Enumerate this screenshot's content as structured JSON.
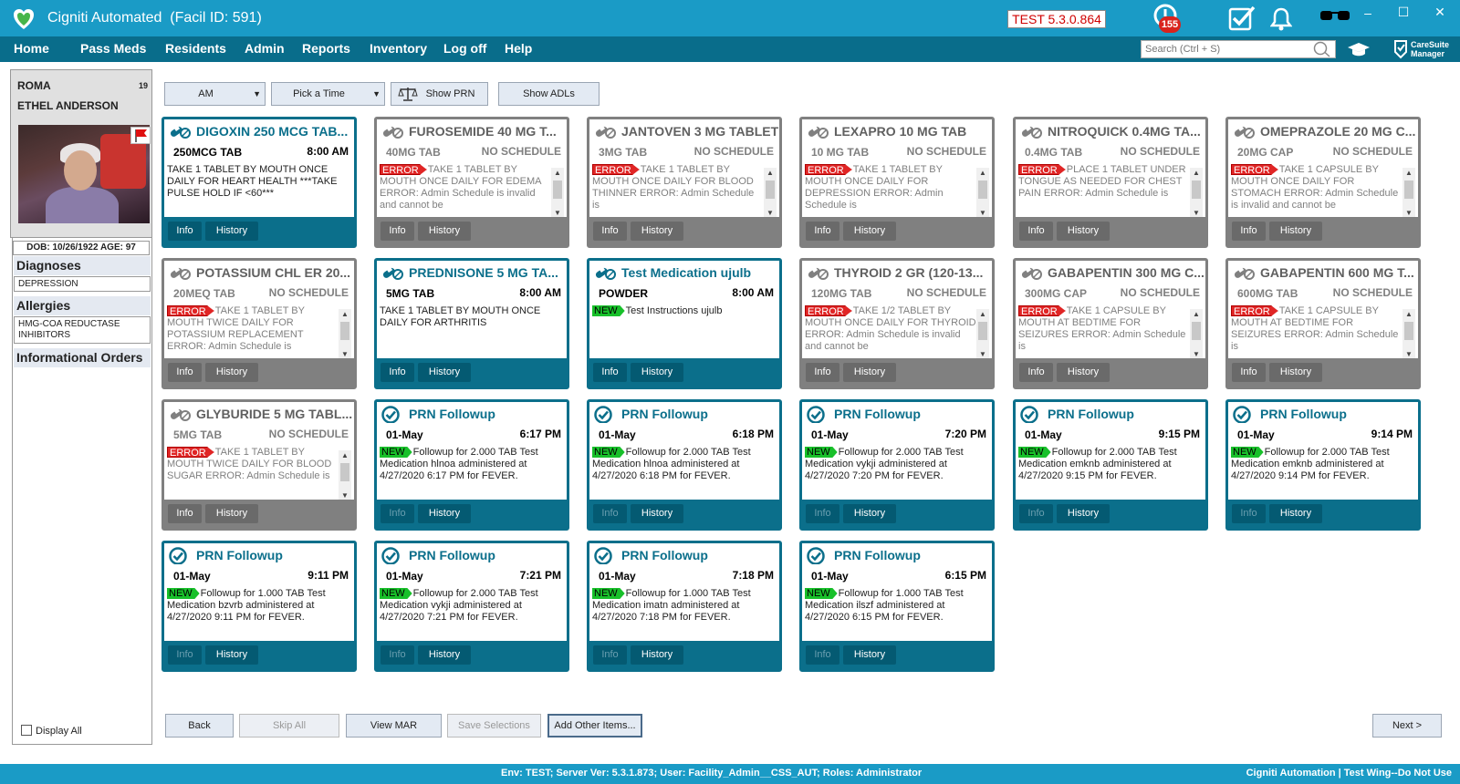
{
  "window": {
    "title": "Cigniti Automated",
    "facility_label": "(Facil ID: 591)",
    "version": "TEST 5.3.0.864",
    "alert_count": "155",
    "controls": [
      "–",
      "☐",
      "✕"
    ]
  },
  "menu": {
    "items": [
      "Home",
      "Pass Meds",
      "Residents",
      "Admin",
      "Reports",
      "Inventory",
      "Log off",
      "Help"
    ]
  },
  "search": {
    "placeholder": "Search (Ctrl + S)"
  },
  "brand": {
    "line1": "CareSuite",
    "line2": "Manager"
  },
  "patient": {
    "room": "ROMA",
    "name": "ETHEL ANDERSON",
    "room_number": "19",
    "dob": "DOB: 10/26/1922 AGE: 97"
  },
  "sidebar": {
    "diagnoses_label": "Diagnoses",
    "diagnoses": "DEPRESSION",
    "allergies_label": "Allergies",
    "allergies": "HMG-COA REDUCTASE INHIBITORS",
    "informational_label": "Informational Orders",
    "display_all": "Display All"
  },
  "toolbar": {
    "period": "AM",
    "time": "Pick a Time",
    "show_prn": "Show PRN",
    "show_adls": "Show ADLs"
  },
  "footer_buttons": {
    "back": "Back",
    "skip_all": "Skip All",
    "view_mar": "View MAR",
    "save_selections": "Save Selections",
    "add_other": "Add Other Items...",
    "next": "Next  >"
  },
  "card_buttons": {
    "info": "Info",
    "history": "History"
  },
  "cards": [
    {
      "title": "DIGOXIN 250 MCG TAB...",
      "dose": "250MCG TAB",
      "time": "8:00 AM",
      "status": "active",
      "badge": "",
      "text": " TAKE 1 TABLET BY MOUTH ONCE DAILY FOR HEART HEALTH    ***TAKE PULSE HOLD IF <60***",
      "icon": "pills-icon",
      "scroll": false
    },
    {
      "title": "FUROSEMIDE 40 MG T...",
      "dose": "40MG TAB",
      "time": "NO SCHEDULE",
      "status": "inactive",
      "badge": "ERROR",
      "text": "TAKE 1 TABLET BY MOUTH ONCE DAILY FOR EDEMA  ERROR: Admin Schedule is invalid and cannot be",
      "icon": "pills-icon",
      "scroll": true
    },
    {
      "title": "JANTOVEN 3 MG TABLET",
      "dose": "3MG TAB",
      "time": "NO SCHEDULE",
      "status": "inactive",
      "badge": "ERROR",
      "text": "TAKE 1 TABLET BY MOUTH ONCE DAILY FOR BLOOD THINNER  ERROR: Admin Schedule is",
      "icon": "pills-icon",
      "scroll": true
    },
    {
      "title": "LEXAPRO 10 MG TAB",
      "dose": "10 MG TAB",
      "time": "NO SCHEDULE",
      "status": "inactive",
      "badge": "ERROR",
      "text": "TAKE 1 TABLET BY MOUTH ONCE DAILY FOR DEPRESSION  ERROR: Admin Schedule is",
      "icon": "pills-icon",
      "scroll": true
    },
    {
      "title": "NITROQUICK 0.4MG TA...",
      "dose": "0.4MG TAB",
      "time": "NO SCHEDULE",
      "status": "inactive",
      "badge": "ERROR",
      "text": "PLACE 1 TABLET UNDER TONGUE AS NEEDED FOR CHEST PAIN  ERROR: Admin Schedule is",
      "icon": "pills-icon",
      "scroll": true
    },
    {
      "title": "OMEPRAZOLE 20 MG C...",
      "dose": "20MG CAP",
      "time": "NO SCHEDULE",
      "status": "inactive",
      "badge": "ERROR",
      "text": "TAKE 1 CAPSULE BY MOUTH ONCE DAILY FOR STOMACH  ERROR: Admin Schedule is invalid and cannot be",
      "icon": "pills-icon",
      "scroll": true
    },
    {
      "title": "POTASSIUM CHL ER 20...",
      "dose": "20MEQ TAB",
      "time": "NO SCHEDULE",
      "status": "inactive",
      "badge": "ERROR",
      "text": "TAKE 1 TABLET BY MOUTH TWICE DAILY FOR POTASSIUM REPLACEMENT  ERROR: Admin Schedule is",
      "icon": "pills-icon",
      "scroll": true
    },
    {
      "title": "PREDNISONE 5 MG TA...",
      "dose": "5MG TAB",
      "time": "8:00 AM",
      "status": "active",
      "badge": "",
      "text": " TAKE 1 TABLET BY MOUTH ONCE DAILY FOR ARTHRITIS",
      "icon": "pills-icon",
      "scroll": false
    },
    {
      "title": "Test Medication ujulb",
      "dose": "POWDER",
      "time": "8:00 AM",
      "status": "active",
      "badge": "NEW",
      "text": "Test Instructions ujulb",
      "icon": "pills-icon",
      "scroll": false
    },
    {
      "title": "THYROID 2 GR (120-13...",
      "dose": "120MG TAB",
      "time": "NO SCHEDULE",
      "status": "inactive",
      "badge": "ERROR",
      "text": "TAKE 1/2 TABLET BY MOUTH ONCE DAILY FOR THYROID  ERROR: Admin Schedule is invalid and cannot be",
      "icon": "pills-icon",
      "scroll": true
    },
    {
      "title": "GABAPENTIN 300 MG C...",
      "dose": "300MG CAP",
      "time": "NO SCHEDULE",
      "status": "inactive",
      "badge": "ERROR",
      "text": "TAKE 1 CAPSULE BY MOUTH AT BEDTIME FOR SEIZURES  ERROR: Admin Schedule is",
      "icon": "pills-icon",
      "scroll": true
    },
    {
      "title": "GABAPENTIN 600 MG T...",
      "dose": "600MG TAB",
      "time": "NO SCHEDULE",
      "status": "inactive",
      "badge": "ERROR",
      "text": "TAKE 1 CAPSULE BY MOUTH AT BEDTIME FOR SEIZURES  ERROR: Admin Schedule is",
      "icon": "pills-icon",
      "scroll": true
    },
    {
      "title": "GLYBURIDE 5 MG TABL...",
      "dose": "5MG TAB",
      "time": "NO SCHEDULE",
      "status": "inactive",
      "badge": "ERROR",
      "text": "TAKE 1 TABLET BY MOUTH TWICE DAILY FOR BLOOD SUGAR  ERROR: Admin Schedule is",
      "icon": "pills-icon",
      "scroll": true
    },
    {
      "title": "PRN Followup",
      "dose": "01-May",
      "time": "6:17 PM",
      "status": "active",
      "badge": "NEW",
      "text": "Followup for 2.000 TAB Test Medication hlnoa administered at 4/27/2020 6:17 PM for FEVER.",
      "icon": "check-circle-icon",
      "scroll": false,
      "dim_info": true
    },
    {
      "title": "PRN Followup",
      "dose": "01-May",
      "time": "6:18 PM",
      "status": "active",
      "badge": "NEW",
      "text": "Followup for 2.000 TAB Test Medication hlnoa administered at 4/27/2020 6:18 PM for FEVER.",
      "icon": "check-circle-icon",
      "scroll": false,
      "dim_info": true
    },
    {
      "title": "PRN Followup",
      "dose": "01-May",
      "time": "7:20 PM",
      "status": "active",
      "badge": "NEW",
      "text": "Followup for 2.000 TAB Test Medication vykji administered at 4/27/2020 7:20 PM for FEVER.",
      "icon": "check-circle-icon",
      "scroll": false,
      "dim_info": true
    },
    {
      "title": "PRN Followup",
      "dose": "01-May",
      "time": "9:15 PM",
      "status": "active",
      "badge": "NEW",
      "text": "Followup for 2.000 TAB Test Medication emknb administered at 4/27/2020 9:15 PM for FEVER.",
      "icon": "check-circle-icon",
      "scroll": false,
      "dim_info": true
    },
    {
      "title": "PRN Followup",
      "dose": "01-May",
      "time": "9:14 PM",
      "status": "active",
      "badge": "NEW",
      "text": "Followup for 2.000 TAB Test Medication emknb administered at 4/27/2020 9:14 PM for FEVER.",
      "icon": "check-circle-icon",
      "scroll": false,
      "dim_info": true
    },
    {
      "title": "PRN Followup",
      "dose": "01-May",
      "time": "9:11 PM",
      "status": "active",
      "badge": "NEW",
      "text": "Followup for 1.000 TAB Test Medication bzvrb administered at 4/27/2020 9:11 PM for FEVER.",
      "icon": "check-circle-icon",
      "scroll": false,
      "dim_info": true
    },
    {
      "title": "PRN Followup",
      "dose": "01-May",
      "time": "7:21 PM",
      "status": "active",
      "badge": "NEW",
      "text": "Followup for 2.000 TAB Test Medication vykji administered at 4/27/2020 7:21 PM for FEVER.",
      "icon": "check-circle-icon",
      "scroll": false,
      "dim_info": true
    },
    {
      "title": "PRN Followup",
      "dose": "01-May",
      "time": "7:18 PM",
      "status": "active",
      "badge": "NEW",
      "text": "Followup for 1.000 TAB Test Medication imatn administered at 4/27/2020 7:18 PM for FEVER.",
      "icon": "check-circle-icon",
      "scroll": false,
      "dim_info": true
    },
    {
      "title": "PRN Followup",
      "dose": "01-May",
      "time": "6:15 PM",
      "status": "active",
      "badge": "NEW",
      "text": "Followup for 1.000 TAB Test Medication ilszf administered at 4/27/2020 6:15 PM for FEVER.",
      "icon": "check-circle-icon",
      "scroll": false,
      "dim_info": true
    }
  ],
  "status_bar": {
    "center": "Env: TEST; Server Ver: 5.3.1.873; User: Facility_Admin__CSS_AUT; Roles: Administrator",
    "right": "Cigniti Automation | Test Wing--Do Not Use"
  },
  "colors": {
    "title_bar": "#1a9bc6",
    "menu_bar": "#096d8b",
    "active_card": "#0b6f8b",
    "inactive_card": "#808080",
    "error_badge": "#e02525",
    "new_badge": "#18c02a"
  }
}
